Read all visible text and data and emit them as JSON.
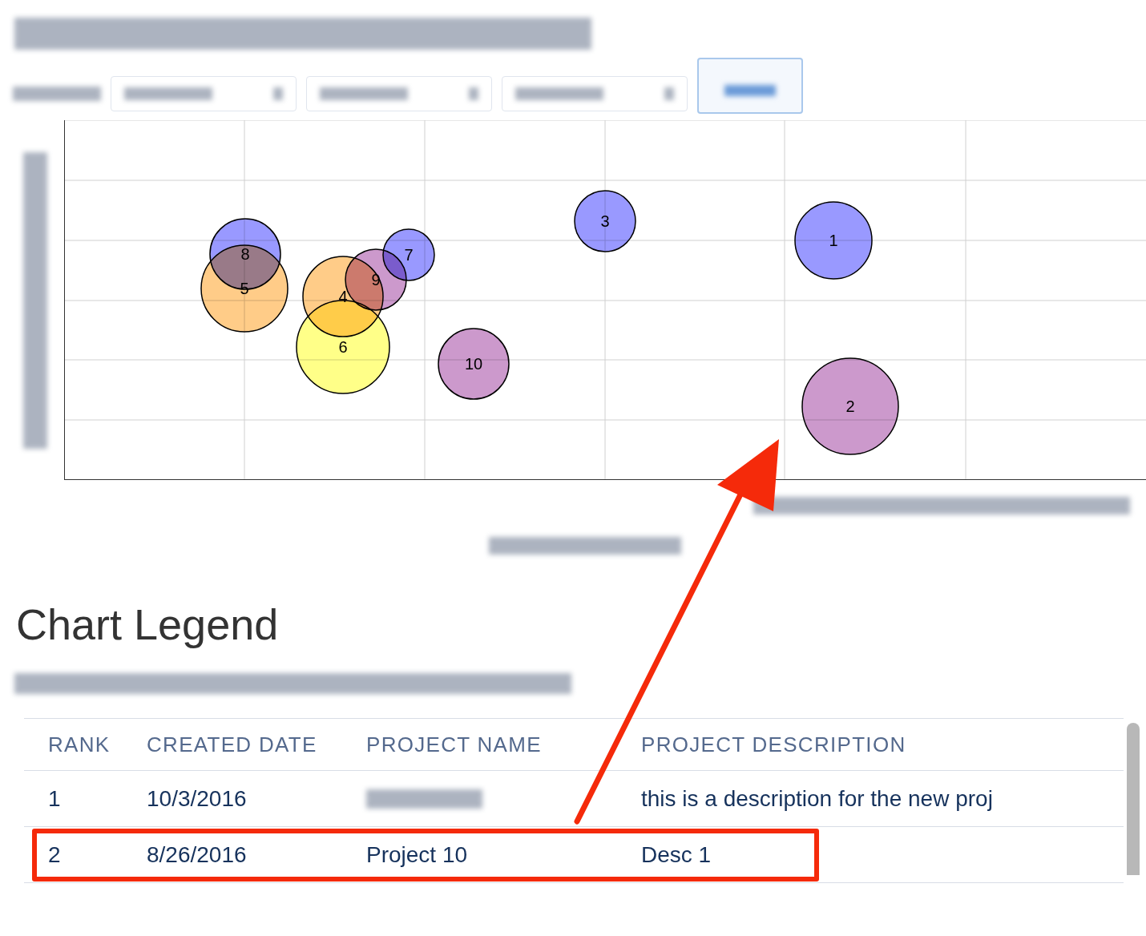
{
  "toolbar": [
    {
      "kind": "dropdown",
      "selected": false
    },
    {
      "kind": "dropdown",
      "selected": false
    },
    {
      "kind": "dropdown",
      "selected": false
    },
    {
      "kind": "button",
      "selected": true
    }
  ],
  "chart": {
    "bubbles": [
      {
        "label": "5",
        "color": "#ffcc88"
      },
      {
        "label": "8",
        "color": "#9999ff"
      },
      {
        "label": "6",
        "color": "#ffff88"
      },
      {
        "label": "4",
        "color": "#ffcc88"
      },
      {
        "label": "9",
        "color": "#cc99cc"
      },
      {
        "label": "7",
        "color": "#9999ff"
      },
      {
        "label": "10",
        "color": "#cc99cc"
      },
      {
        "label": "3",
        "color": "#9999ff"
      },
      {
        "label": "1",
        "color": "#9999ff"
      },
      {
        "label": "2",
        "color": "#cc99cc"
      }
    ]
  },
  "legend": {
    "title": "Chart Legend",
    "columns": [
      "RANK",
      "CREATED DATE",
      "PROJECT NAME",
      "PROJECT DESCRIPTION"
    ],
    "rows": [
      {
        "rank": "1",
        "created_date": "10/3/2016",
        "description": "this is a description for the new proj",
        "annotated": false
      },
      {
        "rank": "2",
        "created_date": "8/26/2016",
        "project_name": "Project 10",
        "description": "Desc 1",
        "annotated": true
      }
    ]
  }
}
